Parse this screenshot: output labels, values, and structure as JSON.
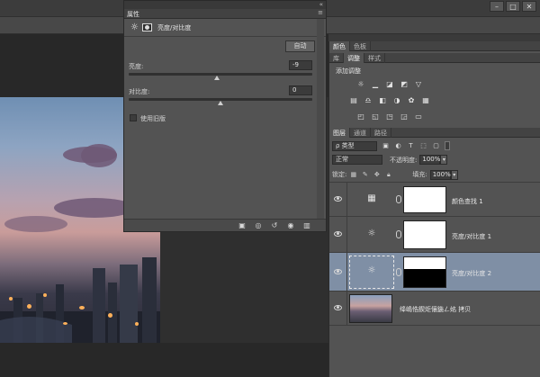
{
  "window": {
    "controls": [
      "–",
      "□",
      "✕"
    ]
  },
  "properties_panel": {
    "tab_label": "属性",
    "menu_glyph": "≡",
    "header_collapse": "«",
    "adjustment_name": "亮度/对比度",
    "auto_button": "自动",
    "brightness": {
      "label": "亮度:",
      "value": "-9",
      "level": 0.48
    },
    "contrast": {
      "label": "对比度:",
      "value": "0",
      "level": 0.5
    },
    "use_legacy_label": "使用旧版",
    "footer_icons": [
      "clip-to-layer-icon",
      "view-previous-icon",
      "reset-icon",
      "visibility-icon",
      "trash-icon"
    ]
  },
  "color_panel": {
    "tabs": [
      "颜色",
      "色板"
    ]
  },
  "adjust_panel": {
    "tabs": [
      "库",
      "调整",
      "样式"
    ],
    "active_tab": "调整",
    "title": "添加调整",
    "row1": [
      "brightness-icon",
      "levels-icon",
      "curves-icon",
      "exposure-icon",
      "gradient-map-icon"
    ],
    "row2": [
      "vibrance-icon",
      "color-balance-icon",
      "black-white-icon",
      "photo-filter-icon",
      "channel-mixer-icon",
      "color-lookup-icon"
    ],
    "row3": [
      "invert-icon",
      "posterize-icon",
      "threshold-icon",
      "selective-color-icon",
      "gradient-fill-icon"
    ]
  },
  "layers_panel": {
    "tabs": [
      "图层",
      "通道",
      "路径"
    ],
    "active_tab": "图层",
    "filter_kind": "ρ 类型",
    "blend_mode": "正常",
    "opacity_label": "不透明度:",
    "opacity": "100%",
    "lock_label": "锁定:",
    "fill_label": "填充:",
    "fill": "100%",
    "layers": [
      {
        "name": "颜色查找 1",
        "type": "color-lookup",
        "selected": false
      },
      {
        "name": "亮度/对比度 1",
        "type": "brightness",
        "selected": false
      },
      {
        "name": "亮度/对比度 2",
        "type": "brightness",
        "selected": true
      },
      {
        "name": "绛嶋悎鍥炬儴鍦ㄥ姳 拷贝",
        "type": "photo",
        "selected": false
      }
    ]
  },
  "colors": {
    "selected_layer": "#7f8fa5",
    "panel_bg": "#535353"
  }
}
